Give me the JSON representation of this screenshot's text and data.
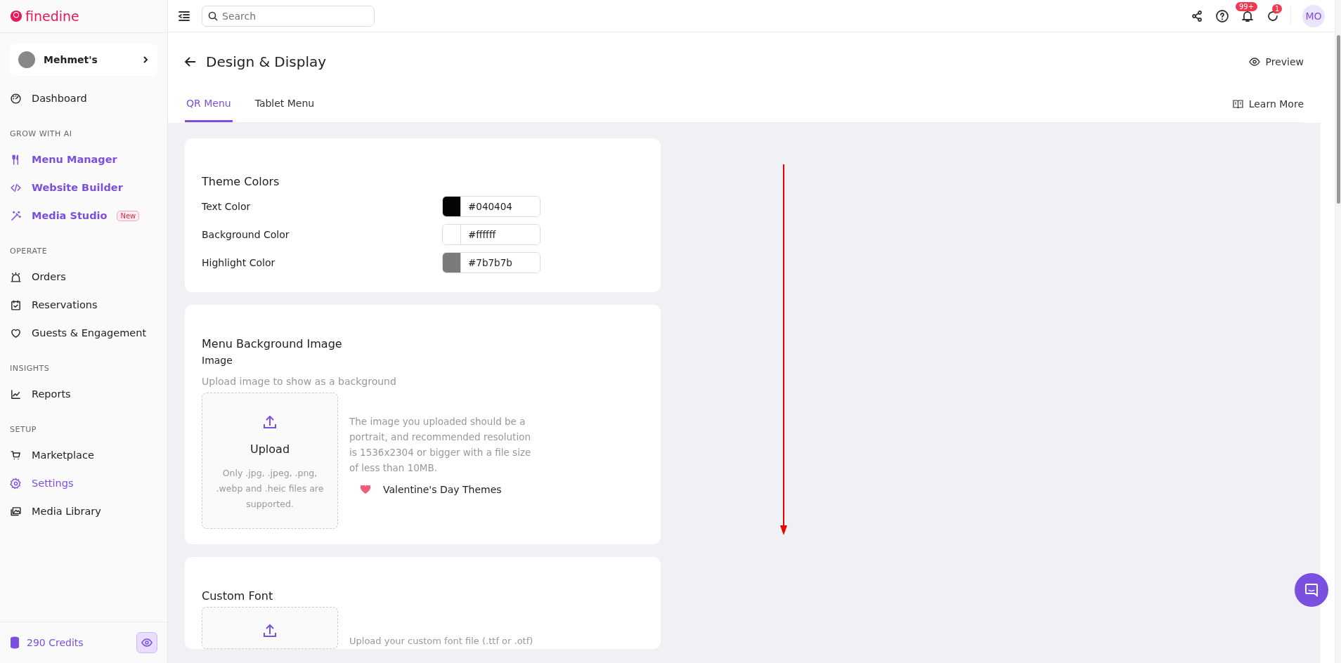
{
  "brand": {
    "name": "finedine"
  },
  "venue": {
    "name": "Mehmet's"
  },
  "sidebar": {
    "sections": [
      {
        "items": [
          {
            "label": "Dashboard",
            "kind": "plain",
            "selected": false
          }
        ]
      },
      {
        "title": "GROW WITH AI",
        "items": [
          {
            "label": "Menu Manager",
            "kind": "ai",
            "selected": false
          },
          {
            "label": "Website Builder",
            "kind": "ai",
            "selected": false
          },
          {
            "label": "Media Studio",
            "kind": "ai",
            "selected": false,
            "badge": "New"
          }
        ]
      },
      {
        "title": "OPERATE",
        "items": [
          {
            "label": "Orders",
            "kind": "plain",
            "selected": false
          },
          {
            "label": "Reservations",
            "kind": "plain",
            "selected": false
          },
          {
            "label": "Guests & Engagement",
            "kind": "plain",
            "selected": false
          }
        ]
      },
      {
        "title": "INSIGHTS",
        "items": [
          {
            "label": "Reports",
            "kind": "plain",
            "selected": false
          }
        ]
      },
      {
        "title": "SETUP",
        "items": [
          {
            "label": "Marketplace",
            "kind": "plain",
            "selected": false
          },
          {
            "label": "Settings",
            "kind": "plain",
            "selected": true
          },
          {
            "label": "Media Library",
            "kind": "plain",
            "selected": false
          }
        ]
      }
    ],
    "credits": "290 Credits"
  },
  "topbar": {
    "search": {
      "placeholder": "Search"
    },
    "notifications_badge": "99+",
    "updates_badge": "1",
    "avatar": "MO"
  },
  "page": {
    "title": "Design & Display",
    "preview": "Preview",
    "learn_more": "Learn More",
    "tabs": [
      {
        "label": "QR Menu",
        "selected": true
      },
      {
        "label": "Tablet Menu",
        "selected": false
      }
    ]
  },
  "theme_colors": {
    "title": "Theme Colors",
    "rows": [
      {
        "label": "Text Color",
        "value": "#040404",
        "color": "#040404"
      },
      {
        "label": "Background Color",
        "value": "#ffffff",
        "color": "#ffffff"
      },
      {
        "label": "Highlight Color",
        "value": "#7b7b7b",
        "color": "#7b7b7b"
      }
    ]
  },
  "background_image": {
    "title": "Menu Background Image",
    "field_label": "Image",
    "hint": "Upload image to show as a background",
    "upload": {
      "label": "Upload",
      "formats": "Only .jpg, .jpeg, .png, .webp and .heic files are supported."
    },
    "info": "The image you uploaded should be a portrait, and recommended resolution is 1536x2304 or bigger with a file size of less than 10MB.",
    "themes_link": "Valentine's Day Themes"
  },
  "custom_font": {
    "title": "Custom Font",
    "hint": "Upload your custom font file (.ttf or .otf)"
  }
}
